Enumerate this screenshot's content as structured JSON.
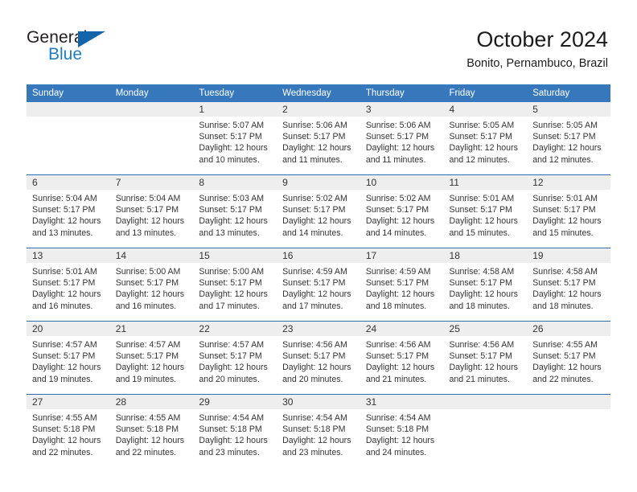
{
  "brand": {
    "name_top": "General",
    "name_bottom": "Blue",
    "accent_color": "#1f7bc1",
    "triangle_color": "#1464aa"
  },
  "header": {
    "title": "October 2024",
    "subtitle": "Bonito, Pernambuco, Brazil"
  },
  "calendar": {
    "header_bg": "#3778bc",
    "daynum_bg": "#eeeeee",
    "separator_color": "#2f6fae",
    "weekday_headers": [
      "Sunday",
      "Monday",
      "Tuesday",
      "Wednesday",
      "Thursday",
      "Friday",
      "Saturday"
    ],
    "weeks": [
      [
        {
          "day": "",
          "sunrise": "",
          "sunset": "",
          "daylight_1": "",
          "daylight_2": ""
        },
        {
          "day": "",
          "sunrise": "",
          "sunset": "",
          "daylight_1": "",
          "daylight_2": ""
        },
        {
          "day": "1",
          "sunrise": "Sunrise: 5:07 AM",
          "sunset": "Sunset: 5:17 PM",
          "daylight_1": "Daylight: 12 hours",
          "daylight_2": "and 10 minutes."
        },
        {
          "day": "2",
          "sunrise": "Sunrise: 5:06 AM",
          "sunset": "Sunset: 5:17 PM",
          "daylight_1": "Daylight: 12 hours",
          "daylight_2": "and 11 minutes."
        },
        {
          "day": "3",
          "sunrise": "Sunrise: 5:06 AM",
          "sunset": "Sunset: 5:17 PM",
          "daylight_1": "Daylight: 12 hours",
          "daylight_2": "and 11 minutes."
        },
        {
          "day": "4",
          "sunrise": "Sunrise: 5:05 AM",
          "sunset": "Sunset: 5:17 PM",
          "daylight_1": "Daylight: 12 hours",
          "daylight_2": "and 12 minutes."
        },
        {
          "day": "5",
          "sunrise": "Sunrise: 5:05 AM",
          "sunset": "Sunset: 5:17 PM",
          "daylight_1": "Daylight: 12 hours",
          "daylight_2": "and 12 minutes."
        }
      ],
      [
        {
          "day": "6",
          "sunrise": "Sunrise: 5:04 AM",
          "sunset": "Sunset: 5:17 PM",
          "daylight_1": "Daylight: 12 hours",
          "daylight_2": "and 13 minutes."
        },
        {
          "day": "7",
          "sunrise": "Sunrise: 5:04 AM",
          "sunset": "Sunset: 5:17 PM",
          "daylight_1": "Daylight: 12 hours",
          "daylight_2": "and 13 minutes."
        },
        {
          "day": "8",
          "sunrise": "Sunrise: 5:03 AM",
          "sunset": "Sunset: 5:17 PM",
          "daylight_1": "Daylight: 12 hours",
          "daylight_2": "and 13 minutes."
        },
        {
          "day": "9",
          "sunrise": "Sunrise: 5:02 AM",
          "sunset": "Sunset: 5:17 PM",
          "daylight_1": "Daylight: 12 hours",
          "daylight_2": "and 14 minutes."
        },
        {
          "day": "10",
          "sunrise": "Sunrise: 5:02 AM",
          "sunset": "Sunset: 5:17 PM",
          "daylight_1": "Daylight: 12 hours",
          "daylight_2": "and 14 minutes."
        },
        {
          "day": "11",
          "sunrise": "Sunrise: 5:01 AM",
          "sunset": "Sunset: 5:17 PM",
          "daylight_1": "Daylight: 12 hours",
          "daylight_2": "and 15 minutes."
        },
        {
          "day": "12",
          "sunrise": "Sunrise: 5:01 AM",
          "sunset": "Sunset: 5:17 PM",
          "daylight_1": "Daylight: 12 hours",
          "daylight_2": "and 15 minutes."
        }
      ],
      [
        {
          "day": "13",
          "sunrise": "Sunrise: 5:01 AM",
          "sunset": "Sunset: 5:17 PM",
          "daylight_1": "Daylight: 12 hours",
          "daylight_2": "and 16 minutes."
        },
        {
          "day": "14",
          "sunrise": "Sunrise: 5:00 AM",
          "sunset": "Sunset: 5:17 PM",
          "daylight_1": "Daylight: 12 hours",
          "daylight_2": "and 16 minutes."
        },
        {
          "day": "15",
          "sunrise": "Sunrise: 5:00 AM",
          "sunset": "Sunset: 5:17 PM",
          "daylight_1": "Daylight: 12 hours",
          "daylight_2": "and 17 minutes."
        },
        {
          "day": "16",
          "sunrise": "Sunrise: 4:59 AM",
          "sunset": "Sunset: 5:17 PM",
          "daylight_1": "Daylight: 12 hours",
          "daylight_2": "and 17 minutes."
        },
        {
          "day": "17",
          "sunrise": "Sunrise: 4:59 AM",
          "sunset": "Sunset: 5:17 PM",
          "daylight_1": "Daylight: 12 hours",
          "daylight_2": "and 18 minutes."
        },
        {
          "day": "18",
          "sunrise": "Sunrise: 4:58 AM",
          "sunset": "Sunset: 5:17 PM",
          "daylight_1": "Daylight: 12 hours",
          "daylight_2": "and 18 minutes."
        },
        {
          "day": "19",
          "sunrise": "Sunrise: 4:58 AM",
          "sunset": "Sunset: 5:17 PM",
          "daylight_1": "Daylight: 12 hours",
          "daylight_2": "and 18 minutes."
        }
      ],
      [
        {
          "day": "20",
          "sunrise": "Sunrise: 4:57 AM",
          "sunset": "Sunset: 5:17 PM",
          "daylight_1": "Daylight: 12 hours",
          "daylight_2": "and 19 minutes."
        },
        {
          "day": "21",
          "sunrise": "Sunrise: 4:57 AM",
          "sunset": "Sunset: 5:17 PM",
          "daylight_1": "Daylight: 12 hours",
          "daylight_2": "and 19 minutes."
        },
        {
          "day": "22",
          "sunrise": "Sunrise: 4:57 AM",
          "sunset": "Sunset: 5:17 PM",
          "daylight_1": "Daylight: 12 hours",
          "daylight_2": "and 20 minutes."
        },
        {
          "day": "23",
          "sunrise": "Sunrise: 4:56 AM",
          "sunset": "Sunset: 5:17 PM",
          "daylight_1": "Daylight: 12 hours",
          "daylight_2": "and 20 minutes."
        },
        {
          "day": "24",
          "sunrise": "Sunrise: 4:56 AM",
          "sunset": "Sunset: 5:17 PM",
          "daylight_1": "Daylight: 12 hours",
          "daylight_2": "and 21 minutes."
        },
        {
          "day": "25",
          "sunrise": "Sunrise: 4:56 AM",
          "sunset": "Sunset: 5:17 PM",
          "daylight_1": "Daylight: 12 hours",
          "daylight_2": "and 21 minutes."
        },
        {
          "day": "26",
          "sunrise": "Sunrise: 4:55 AM",
          "sunset": "Sunset: 5:17 PM",
          "daylight_1": "Daylight: 12 hours",
          "daylight_2": "and 22 minutes."
        }
      ],
      [
        {
          "day": "27",
          "sunrise": "Sunrise: 4:55 AM",
          "sunset": "Sunset: 5:18 PM",
          "daylight_1": "Daylight: 12 hours",
          "daylight_2": "and 22 minutes."
        },
        {
          "day": "28",
          "sunrise": "Sunrise: 4:55 AM",
          "sunset": "Sunset: 5:18 PM",
          "daylight_1": "Daylight: 12 hours",
          "daylight_2": "and 22 minutes."
        },
        {
          "day": "29",
          "sunrise": "Sunrise: 4:54 AM",
          "sunset": "Sunset: 5:18 PM",
          "daylight_1": "Daylight: 12 hours",
          "daylight_2": "and 23 minutes."
        },
        {
          "day": "30",
          "sunrise": "Sunrise: 4:54 AM",
          "sunset": "Sunset: 5:18 PM",
          "daylight_1": "Daylight: 12 hours",
          "daylight_2": "and 23 minutes."
        },
        {
          "day": "31",
          "sunrise": "Sunrise: 4:54 AM",
          "sunset": "Sunset: 5:18 PM",
          "daylight_1": "Daylight: 12 hours",
          "daylight_2": "and 24 minutes."
        },
        {
          "day": "",
          "sunrise": "",
          "sunset": "",
          "daylight_1": "",
          "daylight_2": ""
        },
        {
          "day": "",
          "sunrise": "",
          "sunset": "",
          "daylight_1": "",
          "daylight_2": ""
        }
      ]
    ]
  }
}
